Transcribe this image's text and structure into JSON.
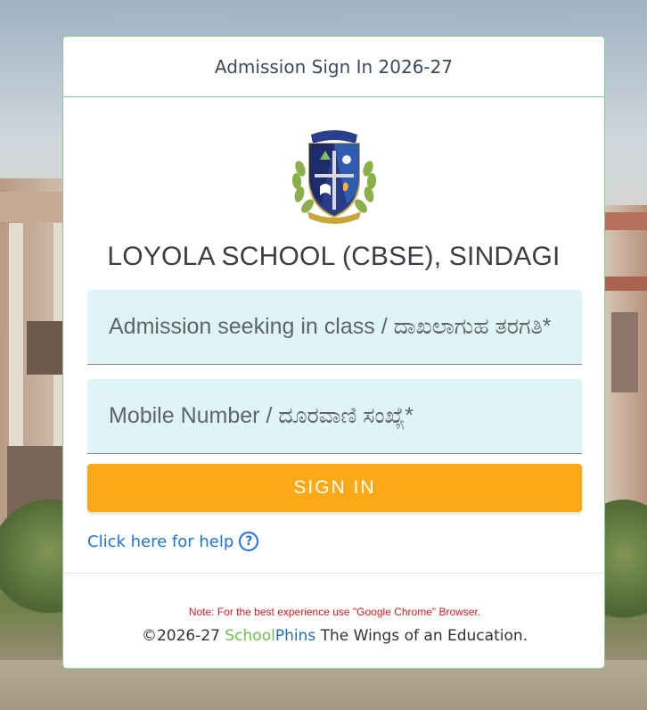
{
  "header": {
    "title": "Admission Sign In 2026-27"
  },
  "school": {
    "name": "LOYOLA SCHOOL (CBSE), SINDAGI",
    "logo_icon": "school-crest-logo"
  },
  "form": {
    "class_field": {
      "placeholder": "Admission seeking in class / ದಾಖಲಾಗುಹ ತರಗತಿ*",
      "value": ""
    },
    "mobile_field": {
      "placeholder": "Mobile Number / ದೂರವಾಣಿ ಸಂಖ್ಯೆ*",
      "value": ""
    },
    "signin_label": "SIGN IN",
    "help_label": "Click here for help",
    "help_icon": "question-circle-icon"
  },
  "footer": {
    "note": "Note: For the best experience use \"Google Chrome\" Browser.",
    "copyright_prefix": "©2026-27 ",
    "brand_school": "School",
    "brand_phins": "Phins",
    "tagline": " The Wings of an Education."
  },
  "colors": {
    "accent": "#fca918",
    "card_border": "#7ad48a",
    "field_bg": "#dff4f8",
    "link": "#1a73e8",
    "note": "#e8161b"
  }
}
